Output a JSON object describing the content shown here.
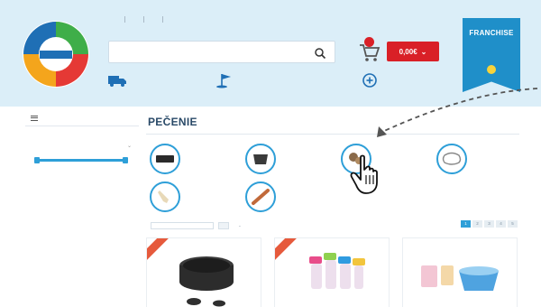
{
  "topnav": {
    "links": [
      "",
      "",
      "",
      ""
    ],
    "login": ""
  },
  "search": {
    "placeholder": ""
  },
  "cart": {
    "count": "",
    "total": "0,00€"
  },
  "franchise": {
    "title": "FRANCHISE",
    "subtitle": ""
  },
  "info": [
    {
      "icon": "truck-icon",
      "title": "",
      "text": ""
    },
    {
      "icon": "flag-icon",
      "title": "",
      "text": ""
    },
    {
      "icon": "plus-circle-icon",
      "title": "",
      "text": ""
    }
  ],
  "sidebar": {
    "header": "",
    "section_title": "",
    "items": [
      "",
      "",
      "",
      "",
      "",
      "",
      ""
    ],
    "price_title": "",
    "price_min": "",
    "price_max": ""
  },
  "content": {
    "title": "PEČENIE",
    "all_products": "",
    "subcategories": [
      "",
      "",
      "",
      "",
      "",
      ""
    ],
    "filter_sort_label": "",
    "filter_sort_value": "",
    "filter_show_label": "",
    "pages": [
      "1",
      "2",
      "3",
      "4",
      "5"
    ],
    "sale_badge": ""
  },
  "colors": {
    "accent": "#2e9fd8",
    "brand_red": "#d92027",
    "header_bg": "#dbeef8",
    "title": "#2a4a68"
  }
}
